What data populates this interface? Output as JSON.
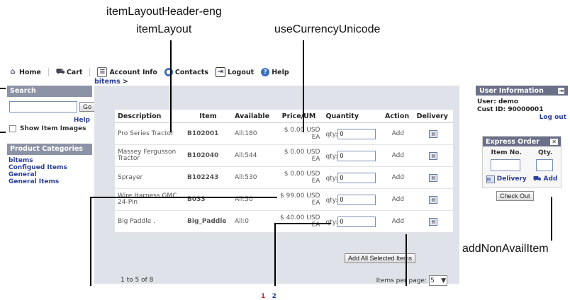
{
  "callouts": {
    "item_layout_header": "itemLayoutHeader-eng",
    "item_layout": "itemLayout",
    "use_currency_unicode": "useCurrencyUnicode",
    "add_non_avail_item": "addNonAvailItem"
  },
  "nav": {
    "home": "Home",
    "cart": "Cart",
    "account_info": "Account Info",
    "contacts": "Contacts",
    "logout": "Logout",
    "help": "Help"
  },
  "breadcrumb": {
    "link": "bitems",
    "sep": ">"
  },
  "search": {
    "header": "Search",
    "go": "Go",
    "help": "Help",
    "show_images": "Show Item Images"
  },
  "categories": {
    "header": "Product Categories",
    "items": [
      "bitems",
      "Configued Items",
      "General",
      "General Items"
    ]
  },
  "table": {
    "headers": [
      "Description",
      "Item",
      "Available",
      "Price/UM",
      "Quantity",
      "Action",
      "Delivery"
    ],
    "qty_label": "qty:",
    "rows": [
      {
        "desc": "Pro Series Tractor",
        "item": "B102001",
        "avail": "All:180",
        "price": "$   0.00 USD",
        "um": "EA",
        "qty": "0",
        "action": "Add"
      },
      {
        "desc": "Massey Fergusson Tractor",
        "item": "B102040",
        "avail": "All:544",
        "price": "$   0.00 USD",
        "um": "EA",
        "qty": "0",
        "action": "Add"
      },
      {
        "desc": "Sprayer",
        "item": "B102243",
        "avail": "All:530",
        "price": "$   0.00 USD",
        "um": "EA",
        "qty": "0",
        "action": "Add"
      },
      {
        "desc": "Wire Harness GMC 24-Pin",
        "item": "B033",
        "avail": "All:50",
        "price": "$  99.00 USD",
        "um": "EA",
        "qty": "0",
        "action": "Add"
      },
      {
        "desc": "Big Paddle .",
        "item": "Big_Paddle",
        "avail": "All:0",
        "price": "$  40.00 USD",
        "um": "EA",
        "qty": "0",
        "action": "Add"
      }
    ],
    "add_all": "Add All Selected Items"
  },
  "pager": {
    "info": "1 to 5 of 8",
    "per_page_label": "Items per page:",
    "per_page_value": "5",
    "pages": [
      "1",
      "2"
    ]
  },
  "user_info": {
    "header": "User Information",
    "user": "User: demo",
    "cust_id": "Cust ID: 90000001",
    "logout": "Log out"
  },
  "express": {
    "header": "Express Order",
    "item_no": "Item No.",
    "qty": "Qty.",
    "delivery": "Delivery",
    "add": "Add",
    "checkout": "Check Out"
  },
  "colors": {
    "link": "#2a3f9c",
    "panel_header": "#8d93a6",
    "dark_header": "#6a7088",
    "page_num_active": "#cc2222"
  }
}
